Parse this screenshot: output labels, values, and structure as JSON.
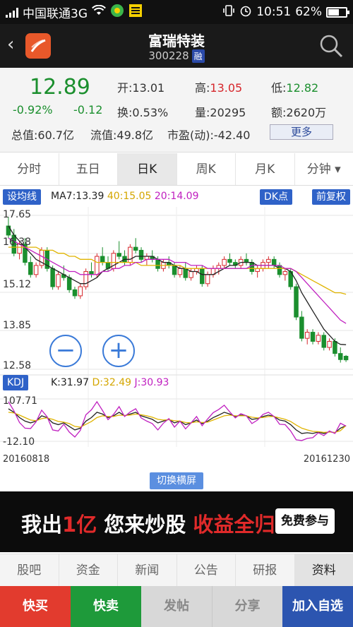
{
  "status_bar": {
    "carrier": "中国联通3G",
    "time": "10:51",
    "battery": "62%",
    "battery_level": 0.62
  },
  "header": {
    "title": "富瑞特装",
    "code": "300228",
    "margin_badge": "融"
  },
  "quote": {
    "price": "12.89",
    "change_pct": "-0.92%",
    "change": "-0.12",
    "open_label": "开:",
    "open": "13.01",
    "high_label": "高:",
    "high": "13.05",
    "low_label": "低:",
    "low": "12.82",
    "turnover_label": "换:",
    "turnover": "0.53%",
    "volume_label": "量:",
    "volume": "20295",
    "amount_label": "额:",
    "amount": "2620万",
    "mktcap_label": "总值:",
    "mktcap": "60.7亿",
    "float_label": "流值:",
    "float_cap": "49.8亿",
    "pe_label": "市盈(动):",
    "pe": "-42.40",
    "more_label": "更多"
  },
  "period_tabs": [
    "分时",
    "五日",
    "日K",
    "周K",
    "月K",
    "分钟 ▾"
  ],
  "chart_controls": {
    "set_ma": "设均线",
    "dk": "DK点",
    "adjust": "前复权",
    "kdj_btn": "KDJ",
    "rotate": "切换横屏"
  },
  "ma_legend": {
    "ma7": "MA7:13.39",
    "ma40": "40:15.05",
    "ma20": "20:14.09"
  },
  "kdj_legend": {
    "k": "K:31.97",
    "d": "D:32.49",
    "j": "J:30.93"
  },
  "colors": {
    "up": "#d6262b",
    "down": "#1b8f2e",
    "ma7": "#222222",
    "ma40": "#e0b400",
    "ma20": "#c020c0",
    "accent": "#2f62c8"
  },
  "chart_data": {
    "type": "candlestick",
    "price_ticks": [
      "17.65",
      "16.38",
      "15.12",
      "13.85",
      "12.58"
    ],
    "kdj_ticks": [
      "107.71",
      "-12.10"
    ],
    "x_start": "20160818",
    "x_end": "20161230",
    "ylim": [
      12.58,
      17.65
    ],
    "kdj_ylim": [
      -12.1,
      107.71
    ],
    "candles": [
      [
        17.3,
        17.6,
        16.9,
        17.0
      ],
      [
        17.0,
        17.2,
        16.3,
        16.4
      ],
      [
        16.4,
        16.8,
        16.2,
        16.7
      ],
      [
        16.7,
        16.9,
        16.0,
        16.1
      ],
      [
        16.1,
        16.3,
        15.6,
        15.7
      ],
      [
        15.7,
        16.1,
        15.6,
        16.0
      ],
      [
        16.0,
        16.6,
        15.9,
        16.5
      ],
      [
        16.5,
        16.6,
        15.8,
        15.9
      ],
      [
        15.9,
        16.0,
        15.2,
        15.3
      ],
      [
        15.3,
        15.8,
        15.2,
        15.7
      ],
      [
        15.7,
        16.0,
        15.5,
        15.6
      ],
      [
        15.6,
        15.7,
        15.1,
        15.2
      ],
      [
        15.2,
        15.3,
        14.9,
        15.0
      ],
      [
        15.0,
        15.4,
        14.9,
        15.3
      ],
      [
        15.3,
        15.9,
        15.2,
        15.8
      ],
      [
        15.8,
        16.1,
        15.6,
        15.7
      ],
      [
        15.7,
        16.4,
        15.6,
        16.3
      ],
      [
        16.3,
        16.6,
        16.0,
        16.1
      ],
      [
        16.1,
        16.3,
        15.8,
        15.9
      ],
      [
        15.9,
        16.5,
        15.8,
        16.4
      ],
      [
        16.4,
        16.8,
        16.2,
        16.3
      ],
      [
        16.3,
        16.5,
        16.0,
        16.1
      ],
      [
        16.1,
        16.7,
        16.0,
        16.6
      ],
      [
        16.6,
        16.9,
        16.4,
        16.5
      ],
      [
        16.5,
        16.6,
        16.1,
        16.2
      ],
      [
        16.2,
        16.4,
        16.0,
        16.3
      ],
      [
        16.3,
        16.5,
        16.1,
        16.2
      ],
      [
        16.2,
        16.3,
        15.8,
        15.9
      ],
      [
        15.9,
        16.2,
        15.8,
        16.1
      ],
      [
        16.1,
        16.3,
        15.9,
        16.0
      ],
      [
        16.0,
        16.1,
        15.6,
        15.7
      ],
      [
        15.7,
        16.0,
        15.6,
        15.9
      ],
      [
        15.9,
        16.1,
        15.5,
        15.6
      ],
      [
        15.6,
        15.9,
        15.5,
        15.8
      ],
      [
        15.8,
        16.0,
        15.7,
        15.9
      ],
      [
        15.9,
        16.0,
        15.3,
        15.4
      ],
      [
        15.4,
        15.8,
        15.3,
        15.7
      ],
      [
        15.7,
        16.0,
        15.6,
        15.9
      ],
      [
        15.9,
        16.1,
        15.7,
        16.0
      ],
      [
        16.0,
        16.3,
        15.9,
        16.2
      ],
      [
        16.2,
        16.4,
        16.0,
        16.1
      ],
      [
        16.1,
        16.2,
        15.9,
        16.0
      ],
      [
        16.0,
        16.3,
        15.9,
        16.2
      ],
      [
        16.2,
        16.4,
        16.0,
        16.1
      ],
      [
        16.1,
        16.2,
        15.7,
        15.8
      ],
      [
        15.8,
        16.0,
        15.6,
        15.9
      ],
      [
        15.9,
        16.2,
        15.8,
        16.1
      ],
      [
        16.1,
        16.3,
        15.9,
        16.2
      ],
      [
        16.2,
        16.3,
        15.9,
        16.0
      ],
      [
        16.0,
        16.1,
        15.6,
        15.7
      ],
      [
        15.7,
        15.9,
        15.5,
        15.8
      ],
      [
        15.8,
        15.9,
        15.2,
        15.3
      ],
      [
        15.3,
        15.4,
        14.2,
        14.3
      ],
      [
        14.3,
        14.5,
        13.5,
        13.6
      ],
      [
        13.6,
        13.9,
        13.4,
        13.8
      ],
      [
        13.8,
        13.9,
        13.4,
        13.5
      ],
      [
        13.5,
        13.8,
        13.4,
        13.7
      ],
      [
        13.7,
        13.8,
        13.2,
        13.3
      ],
      [
        13.3,
        13.6,
        13.2,
        13.5
      ],
      [
        13.5,
        13.6,
        13.0,
        13.1
      ],
      [
        13.1,
        13.3,
        12.8,
        12.9
      ],
      [
        13.01,
        13.05,
        12.82,
        12.89
      ]
    ],
    "series": [
      {
        "name": "MA7",
        "values": [
          17.3,
          17.0,
          16.8,
          16.6,
          16.4,
          16.2,
          16.1,
          16.0,
          15.9,
          15.8,
          15.7,
          15.6,
          15.5,
          15.4,
          15.4,
          15.5,
          15.6,
          15.8,
          15.9,
          16.0,
          16.1,
          16.2,
          16.2,
          16.3,
          16.3,
          16.3,
          16.3,
          16.2,
          16.1,
          16.1,
          16.0,
          15.9,
          15.9,
          15.8,
          15.8,
          15.7,
          15.7,
          15.7,
          15.8,
          15.9,
          16.0,
          16.0,
          16.1,
          16.1,
          16.1,
          16.0,
          16.0,
          16.0,
          16.0,
          15.9,
          15.9,
          15.8,
          15.5,
          15.1,
          14.8,
          14.5,
          14.2,
          13.9,
          13.7,
          13.5,
          13.4,
          13.39
        ]
      },
      {
        "name": "40",
        "values": [
          16.6,
          16.6,
          16.6,
          16.6,
          16.6,
          16.6,
          16.5,
          16.5,
          16.5,
          16.4,
          16.4,
          16.3,
          16.3,
          16.2,
          16.2,
          16.2,
          16.1,
          16.1,
          16.1,
          16.1,
          16.1,
          16.1,
          16.1,
          16.1,
          16.0,
          16.0,
          16.0,
          16.0,
          16.0,
          16.0,
          16.0,
          16.0,
          15.9,
          15.9,
          15.9,
          15.9,
          15.9,
          15.9,
          15.9,
          15.9,
          15.9,
          15.9,
          15.9,
          15.9,
          15.9,
          15.9,
          15.9,
          15.9,
          15.9,
          15.9,
          15.9,
          15.9,
          15.8,
          15.7,
          15.6,
          15.5,
          15.4,
          15.3,
          15.2,
          15.1,
          15.1,
          15.05
        ]
      },
      {
        "name": "20",
        "values": [
          16.9,
          16.8,
          16.7,
          16.6,
          16.5,
          16.4,
          16.3,
          16.2,
          16.1,
          16.0,
          15.9,
          15.8,
          15.8,
          15.7,
          15.7,
          15.7,
          15.7,
          15.8,
          15.8,
          15.9,
          15.9,
          16.0,
          16.0,
          16.1,
          16.1,
          16.2,
          16.2,
          16.2,
          16.2,
          16.2,
          16.1,
          16.1,
          16.1,
          16.0,
          16.0,
          16.0,
          15.9,
          15.9,
          15.9,
          15.9,
          15.9,
          15.9,
          15.9,
          15.9,
          16.0,
          16.0,
          16.0,
          16.0,
          16.0,
          16.0,
          15.9,
          15.9,
          15.8,
          15.6,
          15.4,
          15.2,
          15.0,
          14.8,
          14.6,
          14.4,
          14.2,
          14.09
        ]
      },
      {
        "name": "K",
        "values": [
          80,
          70,
          55,
          45,
          40,
          45,
          60,
          55,
          40,
          35,
          40,
          30,
          20,
          25,
          45,
          55,
          70,
          65,
          55,
          60,
          70,
          60,
          65,
          70,
          60,
          55,
          50,
          40,
          45,
          50,
          40,
          45,
          35,
          40,
          48,
          38,
          45,
          55,
          62,
          70,
          65,
          58,
          62,
          60,
          50,
          52,
          58,
          62,
          58,
          48,
          45,
          35,
          20,
          10,
          12,
          10,
          14,
          10,
          15,
          12,
          25,
          31.97
        ]
      },
      {
        "name": "D",
        "values": [
          70,
          68,
          62,
          55,
          48,
          46,
          52,
          54,
          50,
          44,
          42,
          38,
          30,
          28,
          36,
          44,
          55,
          60,
          58,
          58,
          62,
          61,
          62,
          65,
          63,
          60,
          56,
          50,
          48,
          49,
          46,
          45,
          41,
          40,
          43,
          41,
          42,
          48,
          54,
          60,
          62,
          60,
          60,
          60,
          56,
          54,
          55,
          58,
          58,
          54,
          50,
          44,
          34,
          25,
          20,
          16,
          15,
          13,
          14,
          13,
          18,
          32.49
        ]
      },
      {
        "name": "J",
        "values": [
          100,
          74,
          41,
          25,
          24,
          43,
          76,
          57,
          20,
          17,
          36,
          14,
          0,
          19,
          63,
          77,
          100,
          75,
          49,
          64,
          86,
          58,
          71,
          80,
          54,
          45,
          38,
          20,
          39,
          52,
          28,
          45,
          23,
          40,
          58,
          32,
          51,
          69,
          78,
          90,
          71,
          54,
          66,
          60,
          38,
          48,
          64,
          70,
          58,
          36,
          35,
          17,
          -8,
          -10,
          -4,
          -2,
          12,
          4,
          17,
          10,
          39,
          30.93
        ]
      }
    ]
  },
  "section_tabs": [
    "股吧",
    "资金",
    "新闻",
    "公告",
    "研报",
    "资料"
  ],
  "ad": {
    "p1": "我出",
    "p2": "1亿",
    "p3": " 您来炒股 ",
    "p4": "收益全归您！",
    "button": "免费参与"
  },
  "action_bar": [
    "快买",
    "快卖",
    "发帖",
    "分享",
    "加入自选"
  ]
}
